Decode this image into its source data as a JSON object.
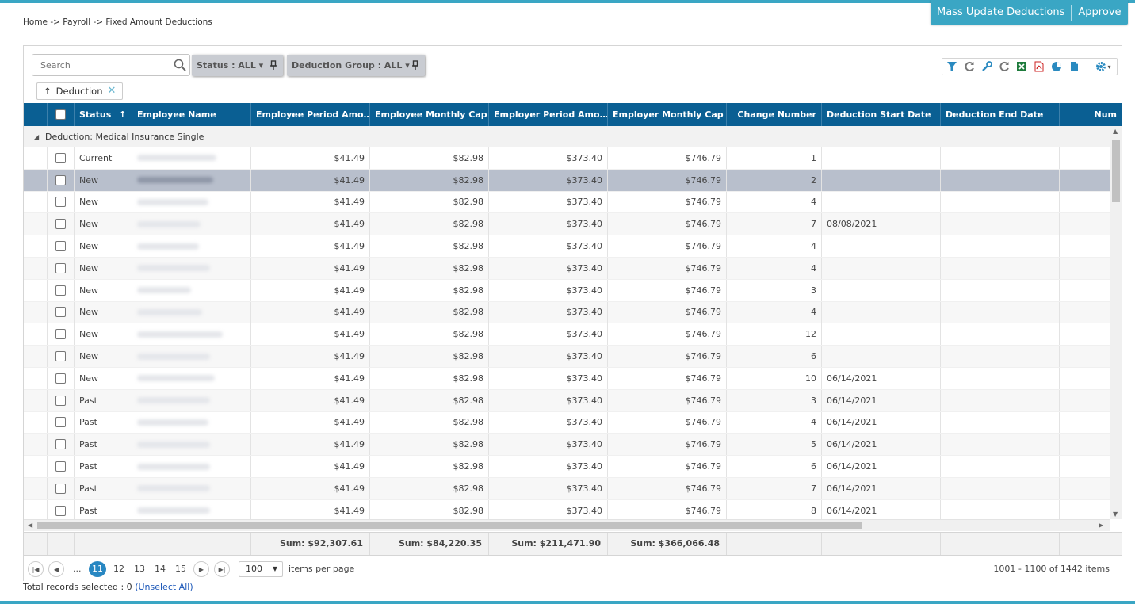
{
  "breadcrumb": "Home -> Payroll -> Fixed Amount Deductions",
  "actions": {
    "mass_update": "Mass Update Deductions",
    "approve": "Approve"
  },
  "search": {
    "placeholder": "Search"
  },
  "filters": {
    "status": "Status : ALL",
    "deduction_group": "Deduction Group : ALL"
  },
  "group_chip": {
    "label": "Deduction"
  },
  "columns": [
    "Status",
    "Employee Name",
    "Employee Period Amo…",
    "Employee Monthly Cap",
    "Employer Period Amo…",
    "Employer Monthly Cap",
    "Change Number",
    "Deduction Start Date",
    "Deduction End Date",
    "Num"
  ],
  "group_row": {
    "label": "Deduction: Medical Insurance Single"
  },
  "rows": [
    {
      "status": "Current",
      "emp_period": "$41.49",
      "emp_cap": "$82.98",
      "er_period": "$373.40",
      "er_cap": "$746.79",
      "change": "1",
      "start": "",
      "end": ""
    },
    {
      "status": "New",
      "emp_period": "$41.49",
      "emp_cap": "$82.98",
      "er_period": "$373.40",
      "er_cap": "$746.79",
      "change": "2",
      "start": "",
      "end": ""
    },
    {
      "status": "New",
      "emp_period": "$41.49",
      "emp_cap": "$82.98",
      "er_period": "$373.40",
      "er_cap": "$746.79",
      "change": "4",
      "start": "",
      "end": ""
    },
    {
      "status": "New",
      "emp_period": "$41.49",
      "emp_cap": "$82.98",
      "er_period": "$373.40",
      "er_cap": "$746.79",
      "change": "7",
      "start": "08/08/2021",
      "end": ""
    },
    {
      "status": "New",
      "emp_period": "$41.49",
      "emp_cap": "$82.98",
      "er_period": "$373.40",
      "er_cap": "$746.79",
      "change": "4",
      "start": "",
      "end": ""
    },
    {
      "status": "New",
      "emp_period": "$41.49",
      "emp_cap": "$82.98",
      "er_period": "$373.40",
      "er_cap": "$746.79",
      "change": "4",
      "start": "",
      "end": ""
    },
    {
      "status": "New",
      "emp_period": "$41.49",
      "emp_cap": "$82.98",
      "er_period": "$373.40",
      "er_cap": "$746.79",
      "change": "3",
      "start": "",
      "end": ""
    },
    {
      "status": "New",
      "emp_period": "$41.49",
      "emp_cap": "$82.98",
      "er_period": "$373.40",
      "er_cap": "$746.79",
      "change": "4",
      "start": "",
      "end": ""
    },
    {
      "status": "New",
      "emp_period": "$41.49",
      "emp_cap": "$82.98",
      "er_period": "$373.40",
      "er_cap": "$746.79",
      "change": "12",
      "start": "",
      "end": ""
    },
    {
      "status": "New",
      "emp_period": "$41.49",
      "emp_cap": "$82.98",
      "er_period": "$373.40",
      "er_cap": "$746.79",
      "change": "6",
      "start": "",
      "end": ""
    },
    {
      "status": "New",
      "emp_period": "$41.49",
      "emp_cap": "$82.98",
      "er_period": "$373.40",
      "er_cap": "$746.79",
      "change": "10",
      "start": "06/14/2021",
      "end": ""
    },
    {
      "status": "Past",
      "emp_period": "$41.49",
      "emp_cap": "$82.98",
      "er_period": "$373.40",
      "er_cap": "$746.79",
      "change": "3",
      "start": "06/14/2021",
      "end": ""
    },
    {
      "status": "Past",
      "emp_period": "$41.49",
      "emp_cap": "$82.98",
      "er_period": "$373.40",
      "er_cap": "$746.79",
      "change": "4",
      "start": "06/14/2021",
      "end": ""
    },
    {
      "status": "Past",
      "emp_period": "$41.49",
      "emp_cap": "$82.98",
      "er_period": "$373.40",
      "er_cap": "$746.79",
      "change": "5",
      "start": "06/14/2021",
      "end": ""
    },
    {
      "status": "Past",
      "emp_period": "$41.49",
      "emp_cap": "$82.98",
      "er_period": "$373.40",
      "er_cap": "$746.79",
      "change": "6",
      "start": "06/14/2021",
      "end": ""
    },
    {
      "status": "Past",
      "emp_period": "$41.49",
      "emp_cap": "$82.98",
      "er_period": "$373.40",
      "er_cap": "$746.79",
      "change": "7",
      "start": "06/14/2021",
      "end": ""
    },
    {
      "status": "Past",
      "emp_period": "$41.49",
      "emp_cap": "$82.98",
      "er_period": "$373.40",
      "er_cap": "$746.79",
      "change": "8",
      "start": "06/14/2021",
      "end": ""
    }
  ],
  "selected_row_index": 1,
  "sums": {
    "emp_period": "Sum: $92,307.61",
    "emp_cap": "Sum: $84,220.35",
    "er_period": "Sum: $211,471.90",
    "er_cap": "Sum: $366,066.48"
  },
  "pager": {
    "ellipsis": "...",
    "pages": [
      "11",
      "12",
      "13",
      "14",
      "15"
    ],
    "active_page": "11",
    "page_size": "100",
    "items_per_page": "items per page",
    "info": "1001 - 1100 of 1442 items"
  },
  "selection": {
    "prefix": "Total records selected : 0",
    "unselect": "(Unselect All)"
  },
  "colors": {
    "accent": "#3aa6c4",
    "header_bg": "#0a5f93",
    "active_page": "#2887c2",
    "selected_row": "#b8bfcc"
  },
  "icons": [
    "search-icon",
    "pin-icon",
    "filter-icon",
    "refresh-icon",
    "wrench-icon",
    "excel-icon",
    "pdf-icon",
    "chart-icon",
    "document-icon",
    "gear-icon",
    "sort-asc-icon",
    "close-icon"
  ]
}
